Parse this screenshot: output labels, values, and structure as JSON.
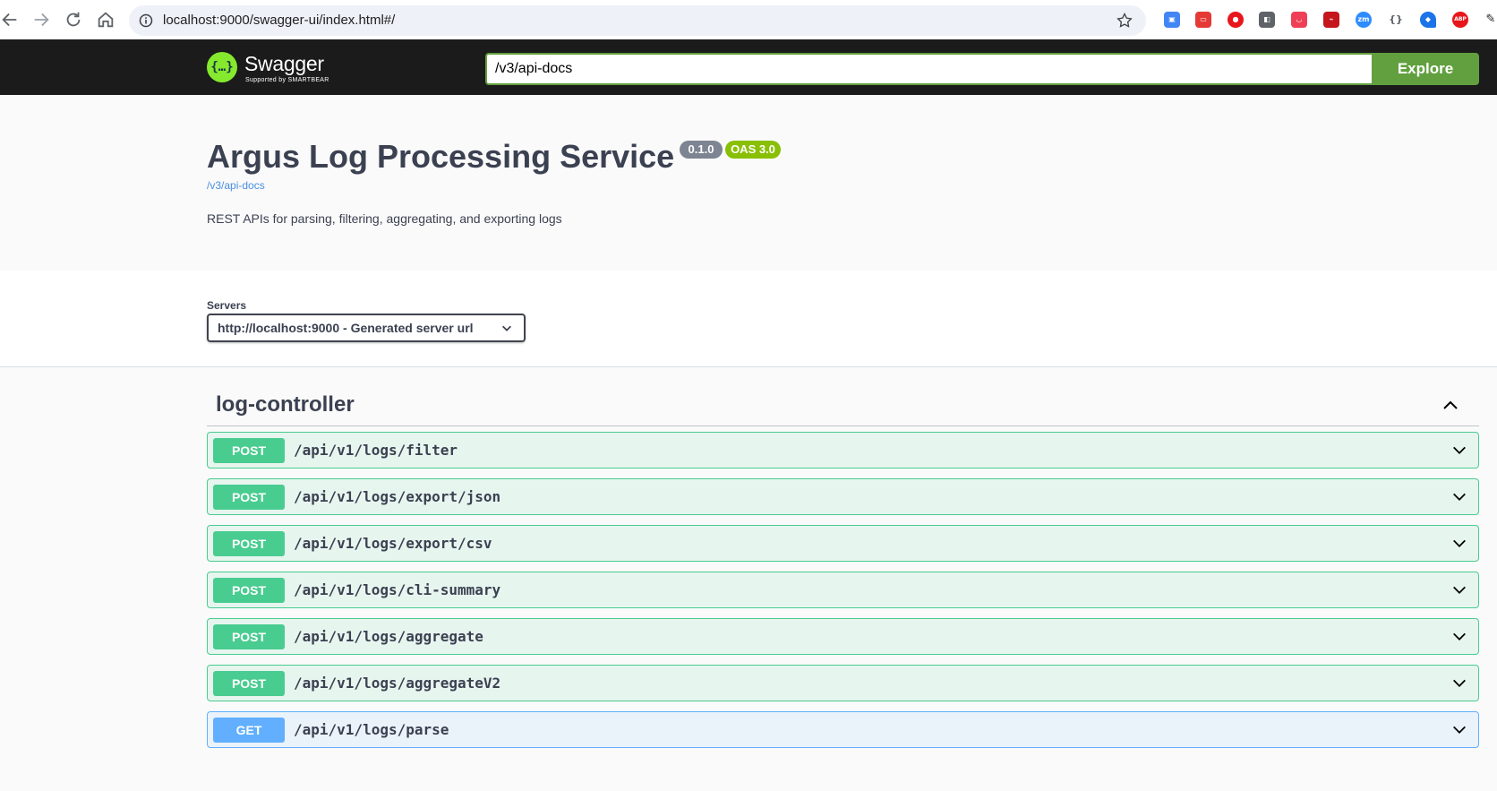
{
  "browser": {
    "url": "localhost:9000/swagger-ui/index.html#/"
  },
  "topbar": {
    "logo_name": "Swagger",
    "logo_sub": "Supported by SMARTBEAR",
    "spec_url": "/v3/api-docs",
    "explore_label": "Explore"
  },
  "info": {
    "title": "Argus Log Processing Service",
    "version": "0.1.0",
    "oas": "OAS 3.0",
    "spec_link": "/v3/api-docs",
    "description": "REST APIs for parsing, filtering, aggregating, and exporting logs"
  },
  "servers": {
    "label": "Servers",
    "selected": "http://localhost:9000 - Generated server url"
  },
  "tag": {
    "name": "log-controller"
  },
  "operations": [
    {
      "method": "POST",
      "path": "/api/v1/logs/filter"
    },
    {
      "method": "POST",
      "path": "/api/v1/logs/export/json"
    },
    {
      "method": "POST",
      "path": "/api/v1/logs/export/csv"
    },
    {
      "method": "POST",
      "path": "/api/v1/logs/cli-summary"
    },
    {
      "method": "POST",
      "path": "/api/v1/logs/aggregate"
    },
    {
      "method": "POST",
      "path": "/api/v1/logs/aggregateV2"
    },
    {
      "method": "GET",
      "path": "/api/v1/logs/parse"
    }
  ],
  "colors": {
    "post": "#49cc90",
    "get": "#61affe",
    "explore": "#62a03f",
    "topbar": "#1b1b1b"
  }
}
